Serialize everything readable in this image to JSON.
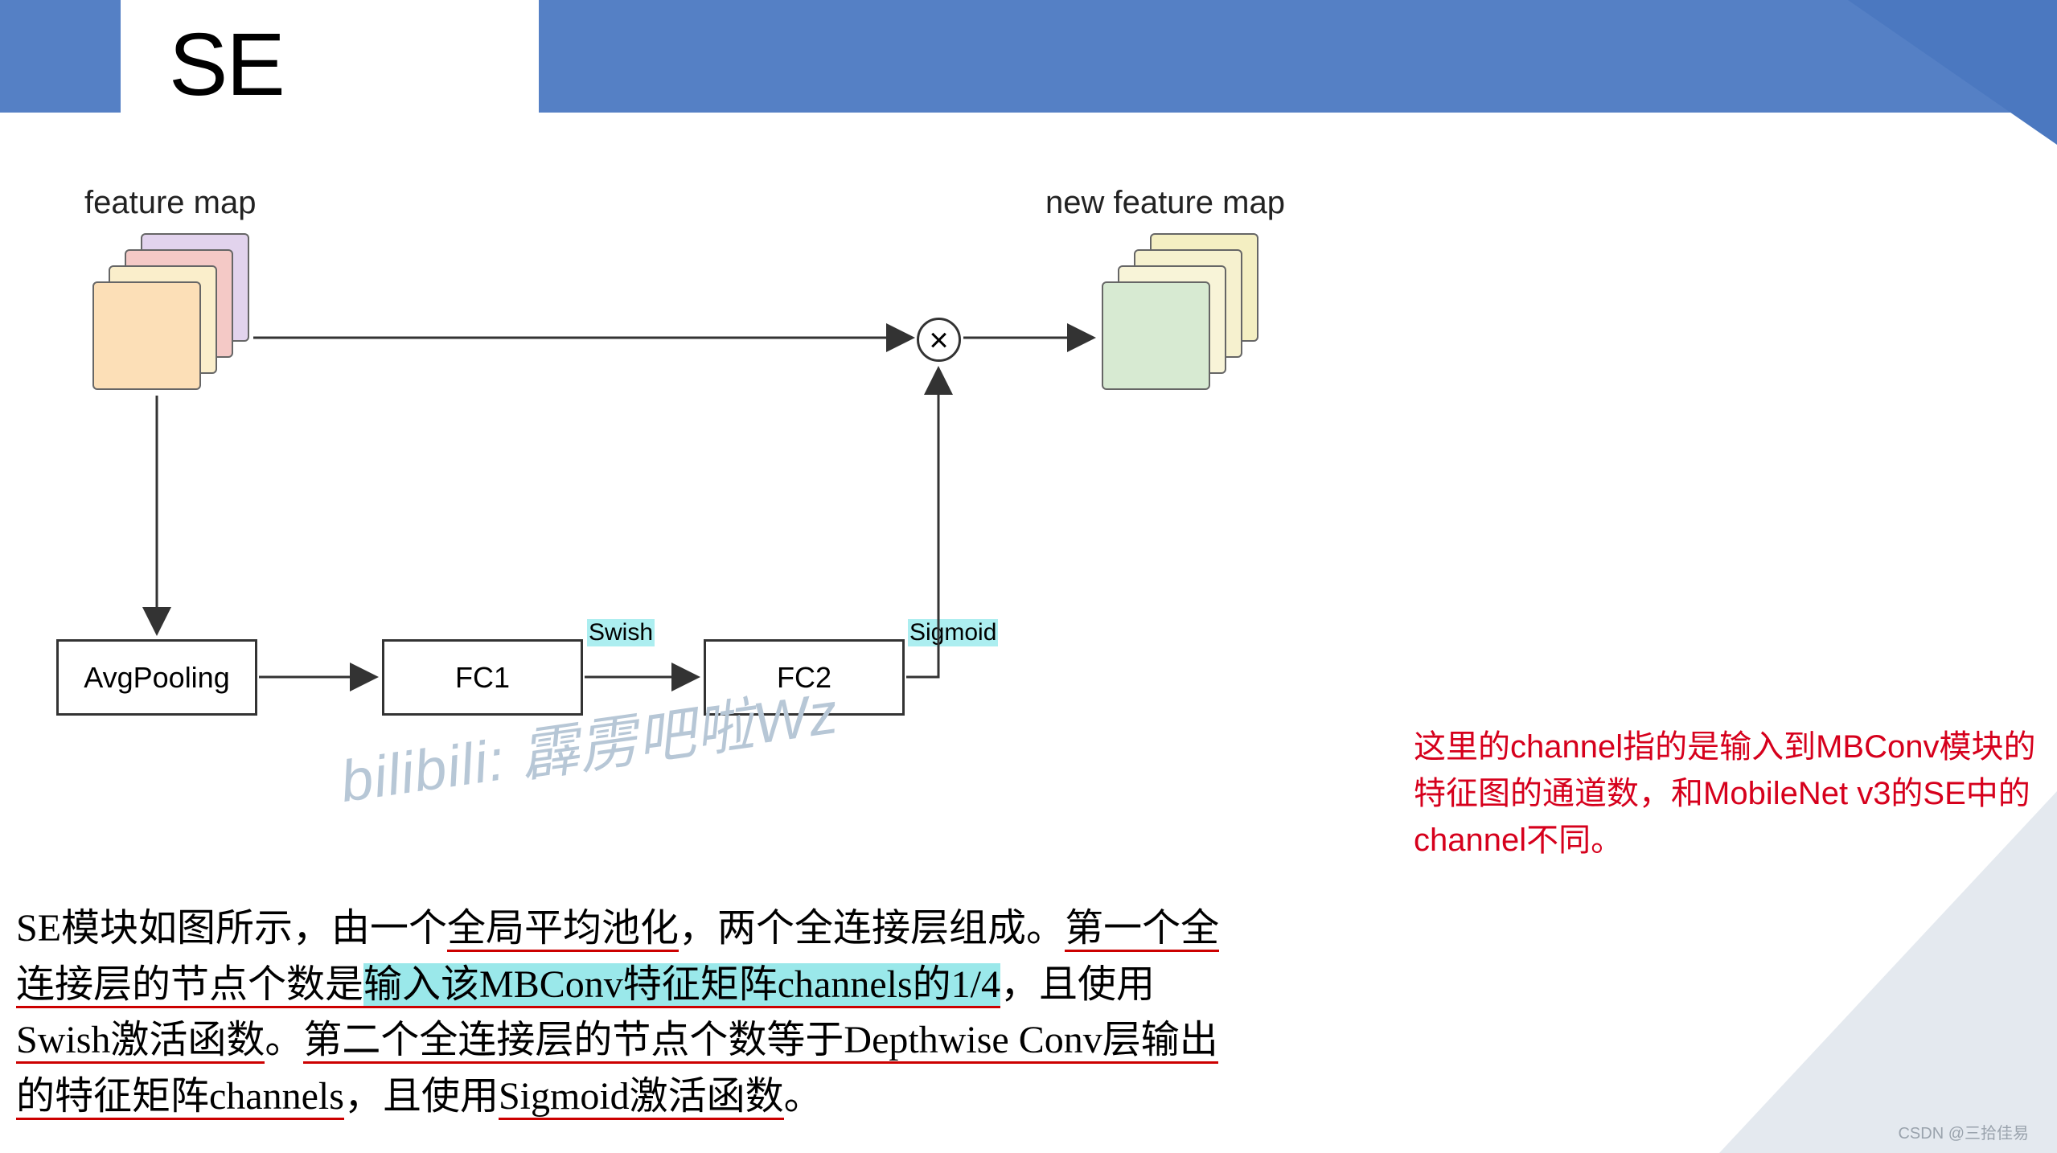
{
  "header": {
    "title": "SE"
  },
  "diagram": {
    "feature_map_label": "feature map",
    "new_feature_map_label": "new feature map",
    "avgpool": "AvgPooling",
    "fc1": "FC1",
    "fc2": "FC2",
    "activ1": "Swish",
    "activ2": "Sigmoid",
    "mult": "×"
  },
  "watermark": "bilibili: 霹雳吧啦Wz",
  "body": {
    "p1_a": "SE模块如图所示，由一个",
    "p1_b": "全局平均池化",
    "p1_c": "，两个全连接层组成。",
    "p1_d": "第一个全连接层的节点个数是",
    "p1_e": "输入该MBConv特征矩阵channels的1/4",
    "p1_f": "，且使用",
    "p1_g": "Swish激活函数",
    "p1_h": "。",
    "p1_i": "第二个全连接层的节点个数等于Depthwise Conv层输出的特征矩阵channels",
    "p1_j": "，且使用",
    "p1_k": "Sigmoid激活函数",
    "p1_l": "。"
  },
  "note": "这里的channel指的是输入到MBConv模块的特征图的通道数，和MobileNet v3的SE中的channel不同。",
  "csdn": "CSDN @三拾佳易"
}
